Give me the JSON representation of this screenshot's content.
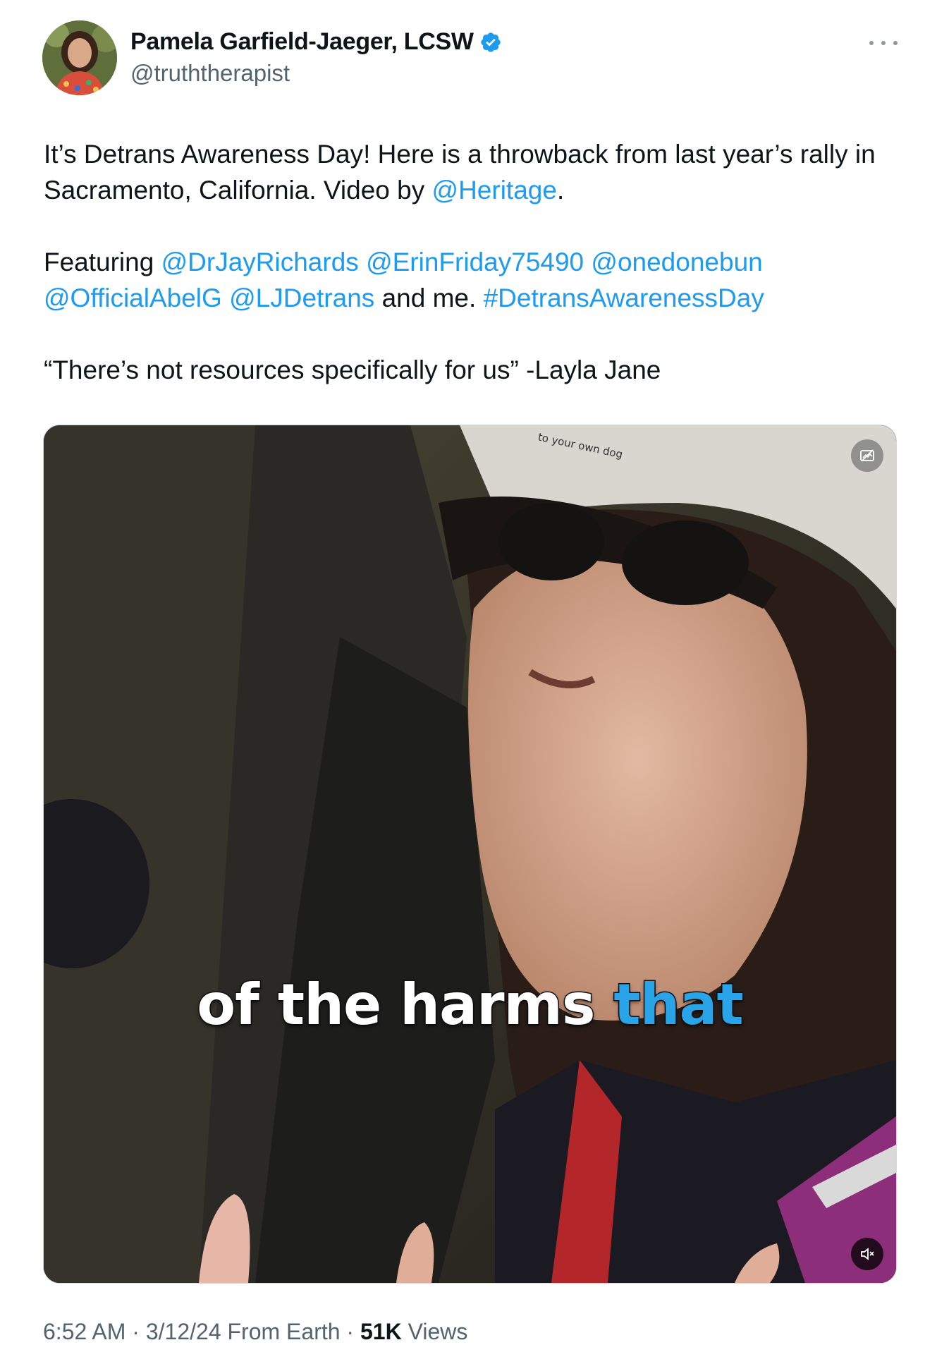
{
  "author": {
    "display_name": "Pamela Garfield-Jaeger, LCSW",
    "handle": "@truththerapist",
    "verified": true,
    "verified_color": "#1d9bf0"
  },
  "tweet": {
    "line1_text": "It’s Detrans Awareness Day! Here is a throwback from last year’s rally in Sacramento, California. Video by ",
    "mention_heritage": "@Heritage",
    "line1_end": ".",
    "featuring_label": "Featuring ",
    "mentions": [
      "@DrJayRichards",
      "@ErinFriday75490",
      "@onedonebun",
      "@OfficialAbelG",
      "@LJDetrans"
    ],
    "and_me": " and me. ",
    "hashtag": "#DetransAwarenessDay",
    "quote": "“There’s not resources specifically for us” -Layla Jane"
  },
  "media": {
    "caption_plain": "of the harms ",
    "caption_highlight": "that",
    "cap_text": "to your own dog",
    "caption_highlight_color": "#2aa4e8"
  },
  "meta": {
    "time": "6:52 AM",
    "sep1": " · ",
    "date": "3/12/24",
    "source": " From Earth",
    "sep2": " · ",
    "views_count": "51K",
    "views_label": " Views"
  },
  "icons": {
    "verified": "verified-badge-icon",
    "more": "more-options-icon",
    "badge": "media-info-icon",
    "mute": "muted-speaker-icon"
  },
  "colors": {
    "link": "#1d9bf0",
    "secondary_text": "#536471",
    "primary_text": "#0f1419"
  }
}
